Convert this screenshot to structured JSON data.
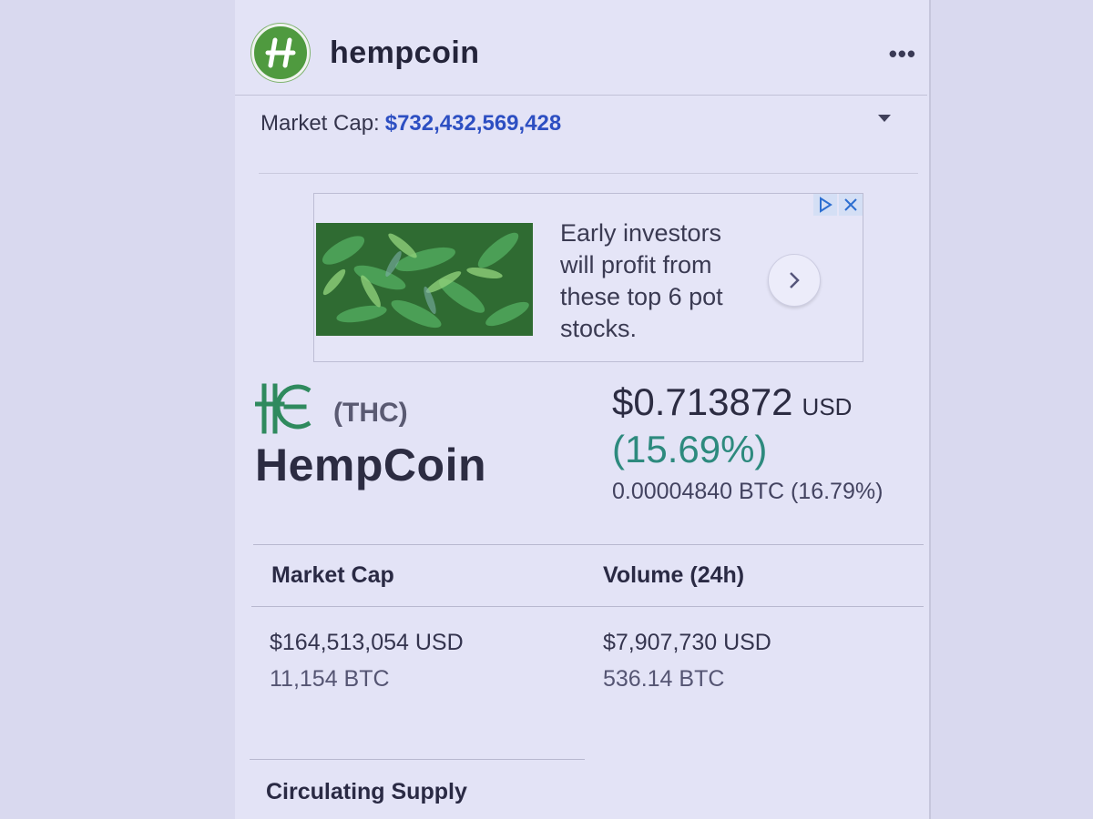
{
  "header": {
    "brand": "hempcoin",
    "more_label": "•••"
  },
  "market_cap_row": {
    "label": "Market Cap:",
    "value": "$732,432,569,428"
  },
  "ad": {
    "text": "Early investors will profit from these top 6 pot stocks.",
    "image": "cannabis-plants-photo"
  },
  "coin": {
    "symbol": "(THC)",
    "name": "HempCoin",
    "price": "$0.713872",
    "price_unit": "USD",
    "change": "(15.69%)",
    "btc_line": "0.00004840 BTC (16.79%)"
  },
  "stats": {
    "market_cap": {
      "label": "Market Cap",
      "usd": "$164,513,054 USD",
      "btc": "11,154 BTC"
    },
    "volume": {
      "label": "Volume (24h)",
      "usd": "$7,907,730 USD",
      "btc": "536.14 BTC"
    },
    "circulating_supply": {
      "label": "Circulating Supply"
    }
  },
  "colors": {
    "accent_link": "#2d4fc2",
    "change_positive": "#2d8a7e",
    "logo_green": "#4f9a3f"
  }
}
